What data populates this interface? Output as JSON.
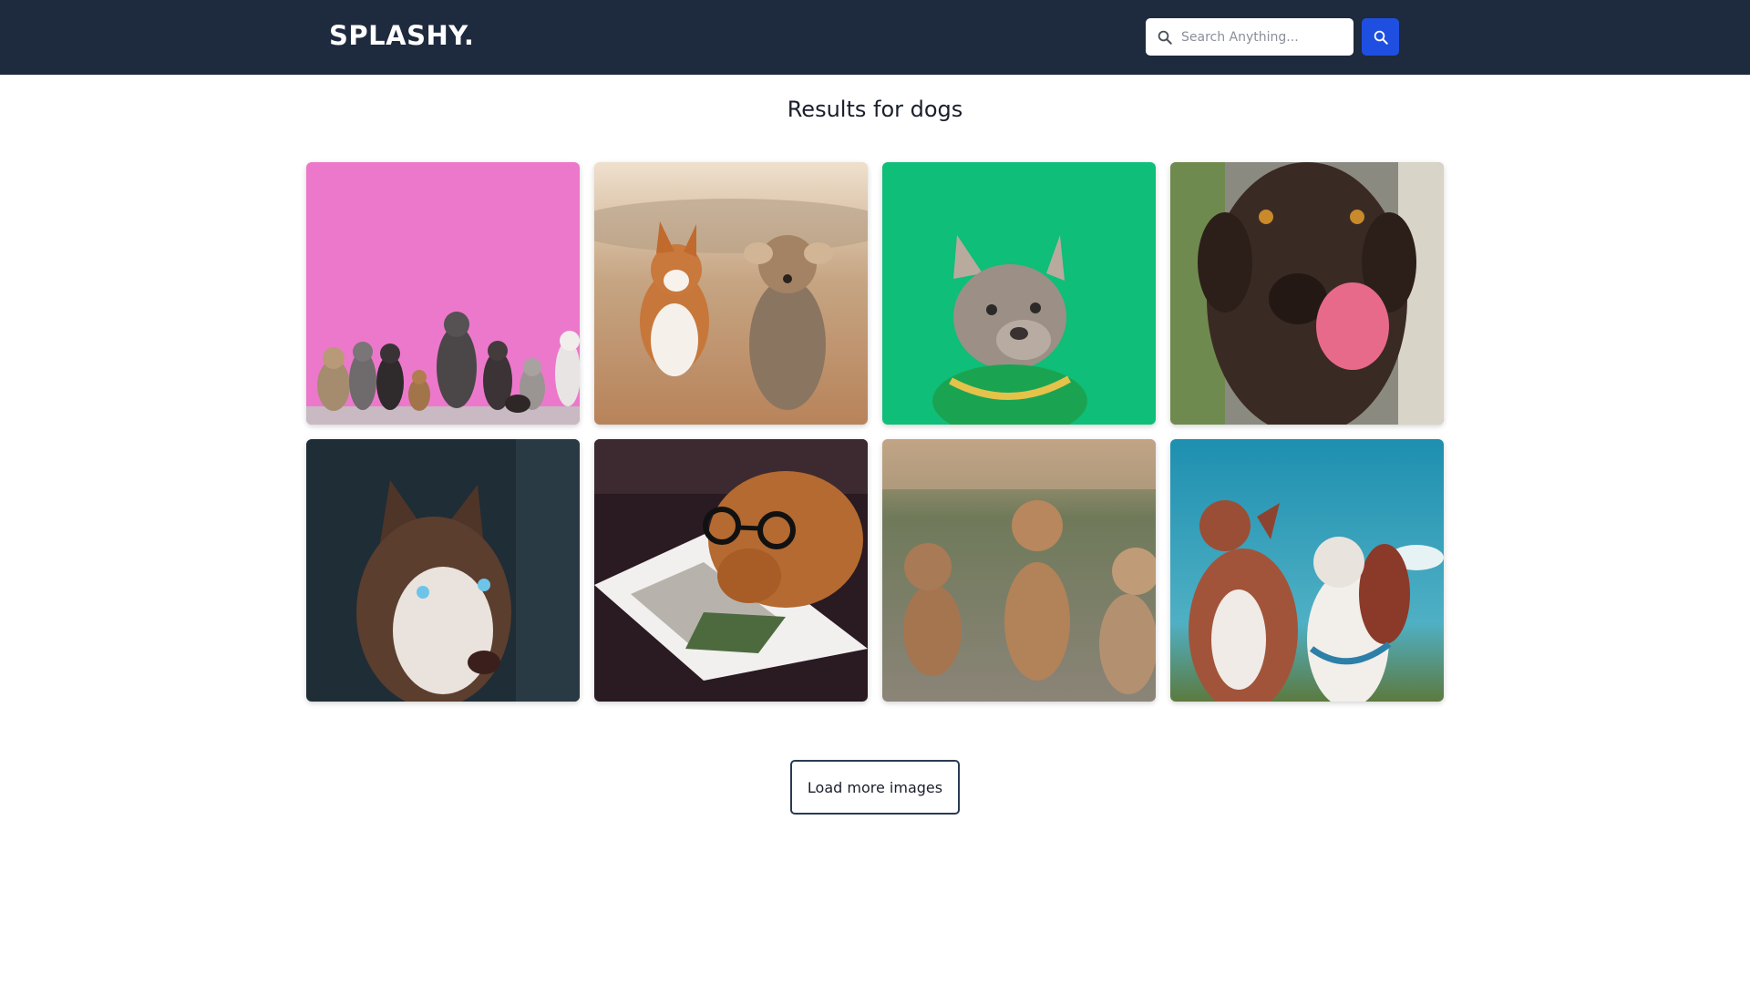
{
  "header": {
    "logo": "SPLASHY.",
    "search": {
      "placeholder": "Search Anything...",
      "value": ""
    },
    "search_button_icon": "search-icon"
  },
  "main": {
    "results_title": "Results for dogs",
    "images": [
      {
        "subject": "dogs-pink-wall"
      },
      {
        "subject": "corgi-and-yorkie-running"
      },
      {
        "subject": "french-bulldog-green"
      },
      {
        "subject": "brown-dog-licking"
      },
      {
        "subject": "husky-portrait"
      },
      {
        "subject": "dog-with-glasses-magazine"
      },
      {
        "subject": "three-puppies"
      },
      {
        "subject": "two-dogs-blue-sky"
      }
    ],
    "load_more_label": "Load more images"
  },
  "colors": {
    "header_bg": "#1e2a3d",
    "accent": "#1f4fe0",
    "button_border": "#2a3a54"
  }
}
